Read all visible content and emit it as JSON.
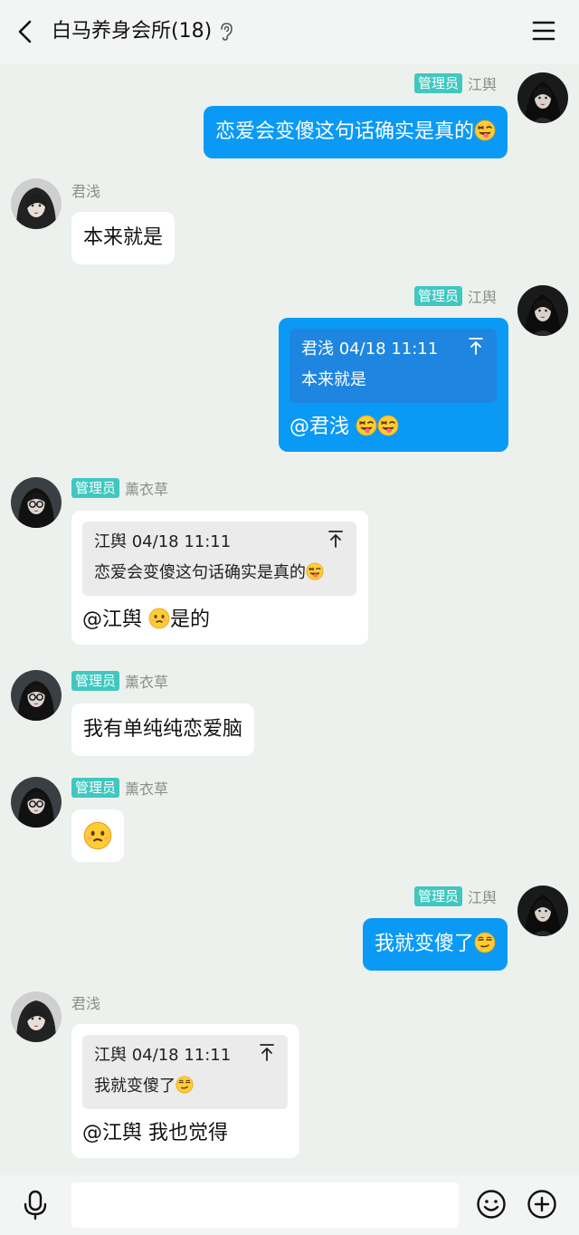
{
  "header": {
    "title": "白马养身会所(18)"
  },
  "messages": [
    {
      "sender": "江舆",
      "badge": "管理员",
      "text": "恋爱会变傻这句话确实是真的"
    },
    {
      "sender": "君浅",
      "text": "本来就是"
    },
    {
      "sender": "江舆",
      "badge": "管理员",
      "quote_header": "君浅 04/18 11:11",
      "quote_text": "本来就是",
      "text": "@君浅 "
    },
    {
      "sender": "薰衣草",
      "badge": "管理员",
      "quote_header": "江舆 04/18 11:11",
      "quote_text": "恋爱会变傻这句话确实是真的",
      "text_prefix": "@江舆 ",
      "text_suffix": "是的"
    },
    {
      "sender": "薰衣草",
      "badge": "管理员",
      "text": "我有单纯纯恋爱脑"
    },
    {
      "sender": "薰衣草",
      "badge": "管理员",
      "text": ""
    },
    {
      "sender": "江舆",
      "badge": "管理员",
      "text": "我就变傻了"
    },
    {
      "sender": "君浅",
      "quote_header": "江舆 04/18 11:11",
      "quote_text": "我就变傻了",
      "text": "@江舆 我也觉得"
    }
  ],
  "input": {
    "value": ""
  },
  "icons": {
    "back": "chevron-left-icon",
    "ear": "ear-icon",
    "menu": "hamburger-menu-icon",
    "mic": "microphone-icon",
    "emoji": "smiley-icon",
    "plus": "plus-circle-icon"
  },
  "colors": {
    "badge": "#40c8c0",
    "blue_bubble": "#0a9af6",
    "background": "#edf1ee"
  }
}
